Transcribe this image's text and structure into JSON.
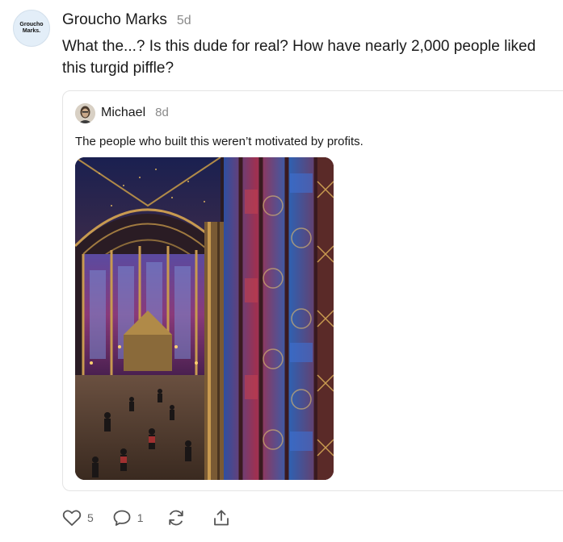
{
  "comment": {
    "avatar_text_line1": "Groucho",
    "avatar_text_line2": "Marks.",
    "author": "Groucho Marks",
    "time": "5d",
    "text": "What the...? Is this dude for real? How have nearly 2,000 people liked this turgid piffle?"
  },
  "quoted_post": {
    "author": "Michael",
    "time": "8d",
    "text": "The people who built this weren’t motivated by profits.",
    "image_subject": "Gothic chapel interior with tall stained glass windows and visitors"
  },
  "actions": {
    "like_icon": "heart-icon",
    "like_count": "5",
    "reply_icon": "comment-icon",
    "reply_count": "1",
    "restack_icon": "restack-icon",
    "share_icon": "share-icon"
  },
  "colors": {
    "text": "#1a1a1a",
    "muted": "#8a8a8a",
    "border": "#e4e4e4",
    "avatar_bg": "#e3eef8"
  }
}
